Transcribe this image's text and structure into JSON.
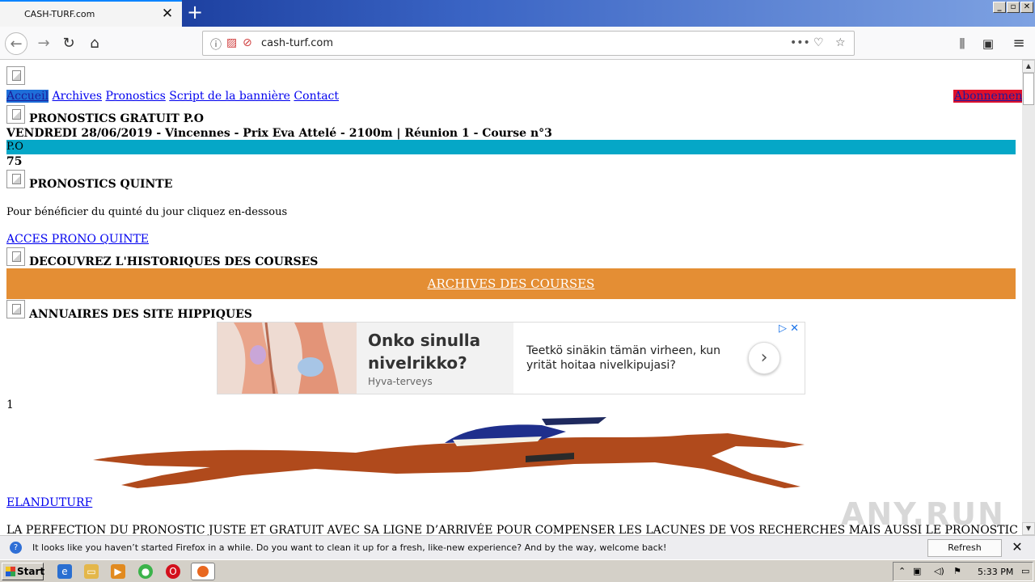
{
  "browser": {
    "tab_title": "CASH-TURF.com",
    "tab_close": "✕",
    "new_tab": "+",
    "url": "cash-turf.com",
    "window_buttons": [
      "_",
      "▫",
      "✕"
    ]
  },
  "site": {
    "nav": [
      "Accueil",
      "Archives",
      "Pronostics",
      "Script de la bannière",
      "Contact"
    ],
    "subscribe_link": "Abonnement",
    "free_heading": "PRONOSTICS GRATUIT P.O",
    "race_line": "VENDREDI 28/06/2019 - Vincennes - Prix Eva Attelé - 2100m | Réunion 1 - Course n°3",
    "po_label": "P.O",
    "po_value": "75",
    "quinte_heading": "PRONOSTICS QUINTE",
    "quinte_text": "Pour bénéficier du quinté du jour cliquez en-dessous",
    "quinte_link": "ACCES PRONO QUINTE",
    "history_heading": "DECOUVREZ L'HISTORIQUES DES COURSES",
    "archives_link": "ARCHIVES DES COURSES",
    "directory_heading": "ANNUAIRES DES SITE HIPPIQUES",
    "counter": "1",
    "elanduturf_link": "ELANDUTURF",
    "bottom_text": "LA PERFECTION DU PRONOSTIC JUSTE ET GRATUIT AVEC SA LIGNE D’ARRIVÉE POUR COMPENSER LES LACUNES DE VOS RECHERCHES MAIS AUSSI LE PRONOSTIC DES"
  },
  "ad": {
    "headline": "Onko sinulla nivelrikko?",
    "sponsor": "Hyva-terveys",
    "body": "Teetkö sinäkin tämän virheen, kun yrität hoitaa nivelkipujasi?",
    "arrow": "›",
    "choices": "▷ ✕"
  },
  "watermark": "ANY.RUN",
  "notification": {
    "text": "It looks like you haven’t started Firefox in a while. Do you want to clean it up for a fresh, like-new experience? And by the way, welcome back!",
    "button": "Refresh Firefox…",
    "close": "✕"
  },
  "taskbar": {
    "start": "Start",
    "clock": "5:33 PM"
  },
  "colors": {
    "po_bar": "#05a7c7",
    "archives_bar": "#e48e34",
    "subscribe_bg": "#e0102a",
    "link": "#0000ee"
  }
}
